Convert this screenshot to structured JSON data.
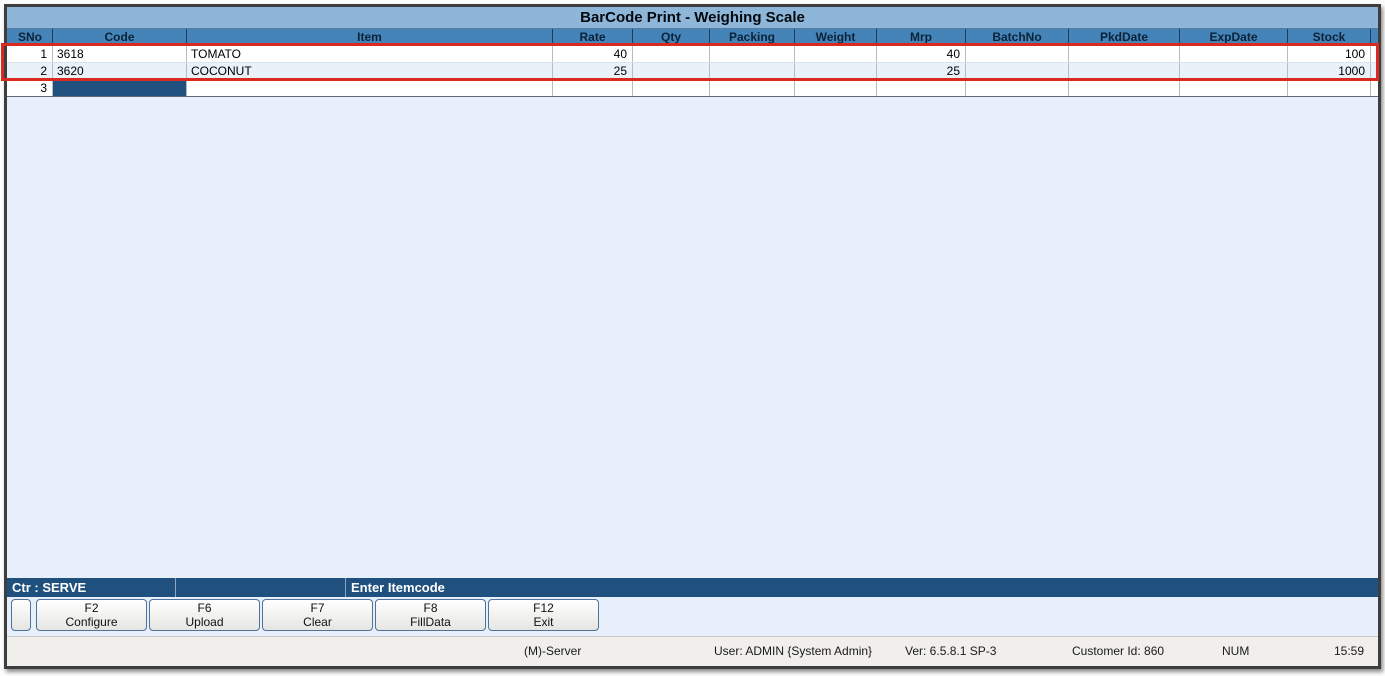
{
  "window": {
    "title": "BarCode Print - Weighing Scale"
  },
  "table": {
    "columns": [
      "SNo",
      "Code",
      "Item",
      "Rate",
      "Qty",
      "Packing",
      "Weight",
      "Mrp",
      "BatchNo",
      "PkdDate",
      "ExpDate",
      "Stock"
    ],
    "rows": [
      {
        "sno": "1",
        "code": "3618",
        "item": "TOMATO",
        "rate": "40",
        "qty": "",
        "packing": "",
        "weight": "",
        "mrp": "40",
        "batchno": "",
        "pkddate": "",
        "expdate": "",
        "stock": "100"
      },
      {
        "sno": "2",
        "code": "3620",
        "item": "COCONUT",
        "rate": "25",
        "qty": "",
        "packing": "",
        "weight": "",
        "mrp": "25",
        "batchno": "",
        "pkddate": "",
        "expdate": "",
        "stock": "1000"
      },
      {
        "sno": "3",
        "code": "",
        "item": "",
        "rate": "",
        "qty": "",
        "packing": "",
        "weight": "",
        "mrp": "",
        "batchno": "",
        "pkddate": "",
        "expdate": "",
        "stock": ""
      }
    ]
  },
  "prompt_bar": {
    "counter_label": "Ctr : SERVE",
    "middle_label": "",
    "prompt_label": "Enter Itemcode"
  },
  "function_buttons": [
    {
      "key": "F2",
      "label": "Configure"
    },
    {
      "key": "F6",
      "label": "Upload"
    },
    {
      "key": "F7",
      "label": "Clear"
    },
    {
      "key": "F8",
      "label": "FillData"
    },
    {
      "key": "F12",
      "label": "Exit"
    }
  ],
  "status_bar": {
    "server": "(M)-Server",
    "user": "User: ADMIN {System Admin}",
    "version": "Ver: 6.5.8.1 SP-3",
    "customer_id": "Customer Id: 860",
    "keyboard_state": "NUM",
    "time": "15:59"
  },
  "colors": {
    "titlebar": "#8db6d8",
    "grid_header": "#4484b8",
    "selection": "#20507d",
    "highlight_annotation": "#da291f",
    "row_alt": "#e9f1f9",
    "workspace": "#e7effa"
  }
}
